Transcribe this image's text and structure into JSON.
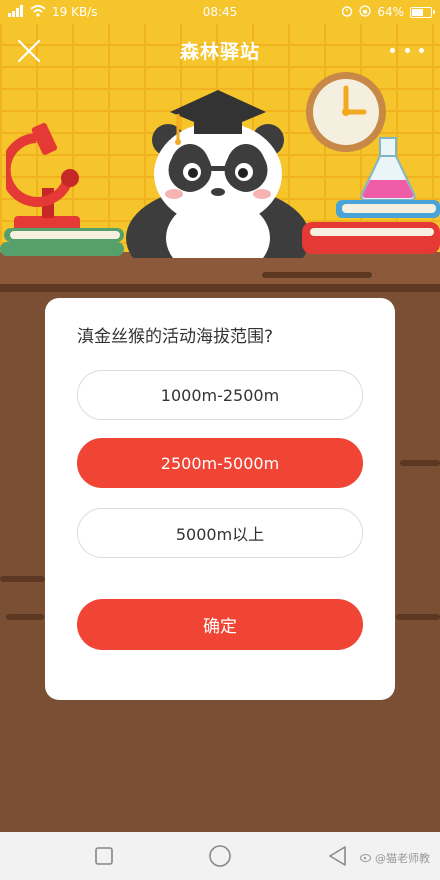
{
  "status_bar": {
    "network_speed": "19 KB/s",
    "time": "08:45",
    "battery_percent": "64%",
    "battery_level": 0.64
  },
  "header": {
    "title": "森林驿站"
  },
  "quiz": {
    "question": "滇金丝猴的活动海拔范围?",
    "options": [
      {
        "label": "1000m-2500m",
        "selected": false
      },
      {
        "label": "2500m-5000m",
        "selected": true
      },
      {
        "label": "5000m以上",
        "selected": false
      }
    ],
    "confirm_label": "确定"
  },
  "watermark": {
    "text": "@猫老师教"
  },
  "colors": {
    "accent": "#f04435",
    "banner_yellow": "#f6c42b",
    "wood": "#7a4f33"
  },
  "icons": {
    "close": "close-icon",
    "more": "more-icon",
    "nav_recent": "square-icon",
    "nav_home": "circle-icon",
    "nav_back": "triangle-back-icon"
  }
}
